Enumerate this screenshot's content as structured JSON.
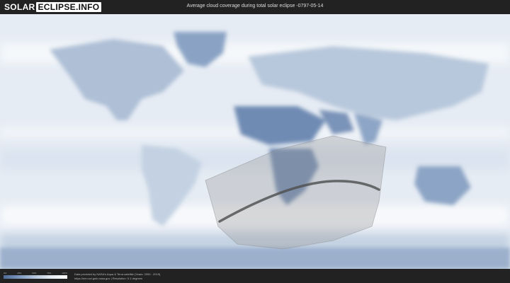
{
  "header": {
    "logo_part1": "SOLAR",
    "logo_part2": "ECLIPSE.INFO",
    "title": "Average cloud coverage during total solar eclipse -0797-05-14"
  },
  "legend": {
    "ticks": [
      "0%",
      "25%",
      "50%",
      "75%",
      "100%"
    ]
  },
  "footer": {
    "credit_line1": "Data provided by NASA's Aqua & Terra satellite (Years: 2000 - 2019)",
    "credit_line2": "https://neo.sci.gsfc.nasa.gov  |  Resolution: 0.1 degrees"
  },
  "colors": {
    "ocean": "#e9eef5",
    "cloud_light": "#f7f9fc",
    "cloud_dark": "#5a79a6",
    "eclipse_zone": "#c9c9c9",
    "totality_path": "#555555"
  }
}
